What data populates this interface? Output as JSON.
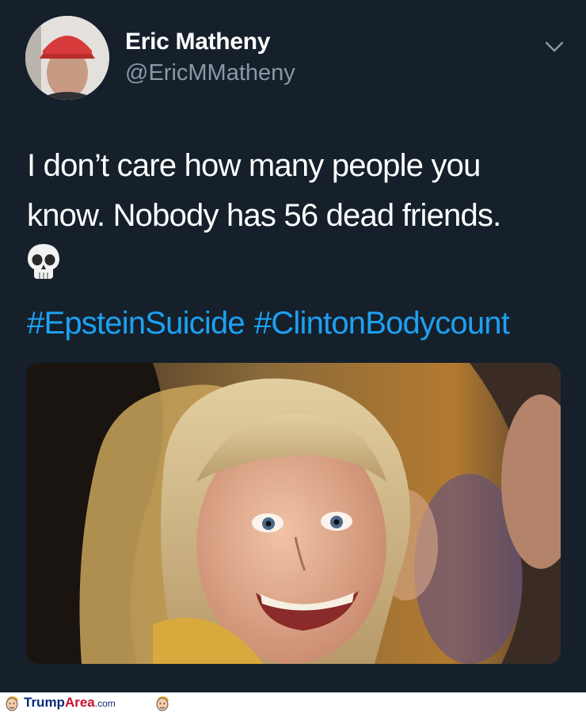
{
  "tweet": {
    "author_name": "Eric Matheny",
    "author_handle": "@EricMMatheny",
    "text_line_1": "I don’t care how many people you",
    "text_line_2": "know. Nobody has 56 dead friends.",
    "emoji": "skull-emoji",
    "hashtags": [
      "#EpsteinSuicide",
      "#ClintonBodycount"
    ],
    "menu_icon": "chevron-down-icon"
  },
  "footer": {
    "brand_part1": "Trump",
    "brand_part2": "Area",
    "brand_part3": ".com"
  },
  "colors": {
    "background": "#15202b",
    "text": "#ffffff",
    "secondary": "#8899a6",
    "link": "#1da1f2"
  }
}
